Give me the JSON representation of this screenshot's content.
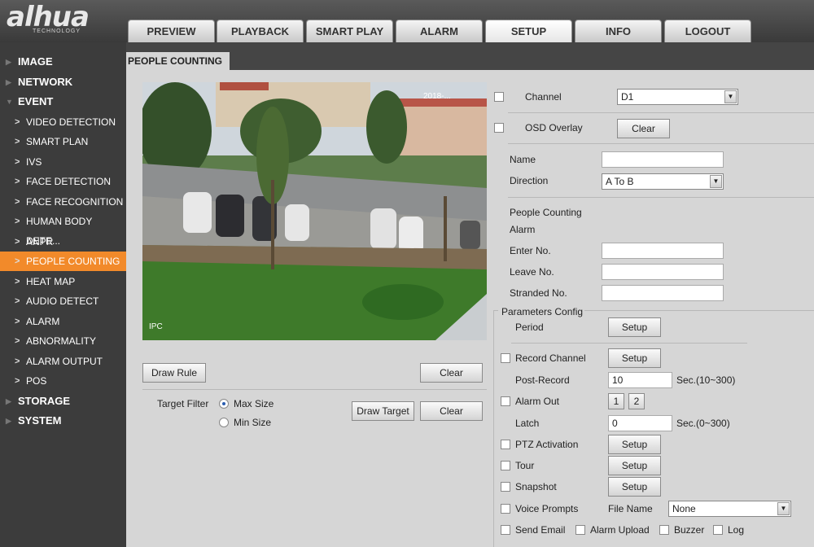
{
  "brand": {
    "logo": "alhua",
    "tagline": "TECHNOLOGY"
  },
  "tabs": [
    {
      "label": "PREVIEW",
      "active": false
    },
    {
      "label": "PLAYBACK",
      "active": false
    },
    {
      "label": "SMART PLAY",
      "active": false
    },
    {
      "label": "ALARM",
      "active": false
    },
    {
      "label": "SETUP",
      "active": true
    },
    {
      "label": "INFO",
      "active": false
    },
    {
      "label": "LOGOUT",
      "active": false
    }
  ],
  "sidebar": {
    "items": [
      {
        "label": "IMAGE",
        "level": "top"
      },
      {
        "label": "NETWORK",
        "level": "top"
      },
      {
        "label": "EVENT",
        "level": "top",
        "expanded": true
      },
      {
        "label": "VIDEO DETECTION",
        "level": "sub"
      },
      {
        "label": "SMART PLAN",
        "level": "sub"
      },
      {
        "label": "IVS",
        "level": "sub"
      },
      {
        "label": "FACE DETECTION",
        "level": "sub"
      },
      {
        "label": "FACE RECOGNITION",
        "level": "sub"
      },
      {
        "label": "HUMAN BODY DETE...",
        "level": "sub"
      },
      {
        "label": "ANPR",
        "level": "sub"
      },
      {
        "label": "PEOPLE COUNTING",
        "level": "sub",
        "active": true
      },
      {
        "label": "HEAT MAP",
        "level": "sub"
      },
      {
        "label": "AUDIO DETECT",
        "level": "sub"
      },
      {
        "label": "ALARM",
        "level": "sub"
      },
      {
        "label": "ABNORMALITY",
        "level": "sub"
      },
      {
        "label": "ALARM OUTPUT",
        "level": "sub"
      },
      {
        "label": "POS",
        "level": "sub"
      },
      {
        "label": "STORAGE",
        "level": "top"
      },
      {
        "label": "SYSTEM",
        "level": "top"
      }
    ]
  },
  "page_title": "PEOPLE COUNTING",
  "video": {
    "overlay_label": "IPC",
    "timestamp": "2018-..."
  },
  "left_controls": {
    "draw_rule": "Draw Rule",
    "clear_rule": "Clear",
    "target_filter_label": "Target Filter",
    "max_size": "Max Size",
    "min_size": "Min Size",
    "filter_selected": "Max Size",
    "draw_target": "Draw Target",
    "clear_target": "Clear"
  },
  "form": {
    "channel_label": "Channel",
    "channel_value": "D1",
    "osd_overlay_label": "OSD Overlay",
    "osd_clear": "Clear",
    "name_label": "Name",
    "name_value": "",
    "direction_label": "Direction",
    "direction_value": "A To B",
    "people_counting_label": "People Counting",
    "alarm_label": "Alarm",
    "enter_label": "Enter No.",
    "enter_value": "",
    "leave_label": "Leave No.",
    "leave_value": "",
    "stranded_label": "Stranded No.",
    "stranded_value": ""
  },
  "params": {
    "section_title": "Parameters Config",
    "period_label": "Period",
    "setup_label": "Setup",
    "record_channel_label": "Record Channel",
    "post_record_label": "Post-Record",
    "post_record_value": "10",
    "post_record_unit": "Sec.(10~300)",
    "alarm_out_label": "Alarm Out",
    "alarm_out_1": "1",
    "alarm_out_2": "2",
    "latch_label": "Latch",
    "latch_value": "0",
    "latch_unit": "Sec.(0~300)",
    "ptz_label": "PTZ Activation",
    "tour_label": "Tour",
    "snapshot_label": "Snapshot",
    "voice_label": "Voice Prompts",
    "file_name_label": "File Name",
    "file_name_value": "None",
    "send_email_label": "Send Email",
    "alarm_upload_label": "Alarm Upload",
    "buzzer_label": "Buzzer",
    "log_label": "Log"
  }
}
